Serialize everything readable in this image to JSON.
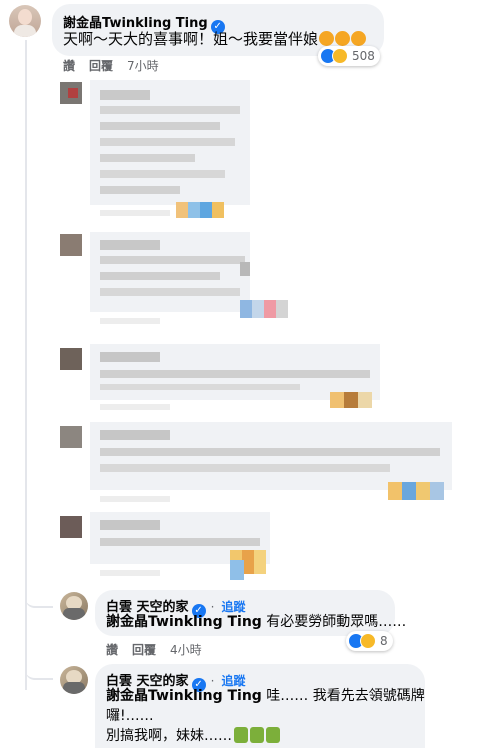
{
  "top_comment": {
    "author": "謝金晶Twinkling Ting",
    "text": "天啊～天大的喜事啊！姐～我要當伴娘",
    "reaction_count": "508",
    "actions": {
      "like": "讚",
      "reply": "回覆",
      "time": "7小時"
    }
  },
  "reply_1": {
    "author": "白雲 天空的家",
    "follow": "追蹤",
    "mention": "謝金晶Twinkling Ting",
    "text": " 有必要勞師動眾嗎……",
    "reaction_count": "8",
    "actions": {
      "like": "讚",
      "reply": "回覆",
      "time": "4小時"
    }
  },
  "reply_2": {
    "author": "白雲 天空的家",
    "follow": "追蹤",
    "mention": "謝金晶Twinkling Ting",
    "text_line1": " 哇…… 我看先去領號碼牌",
    "text_line2": "囉!……",
    "text_line3": "別搞我啊，妹妹……"
  },
  "colors": {
    "accent": "#1877f2",
    "bubble": "#f0f2f5",
    "meta_text": "#65676b"
  },
  "icons": [
    "verified-badge-icon",
    "like-reaction-icon",
    "haha-reaction-icon",
    "heart-eyes-emoji-icon",
    "vomit-emoji-icon"
  ]
}
